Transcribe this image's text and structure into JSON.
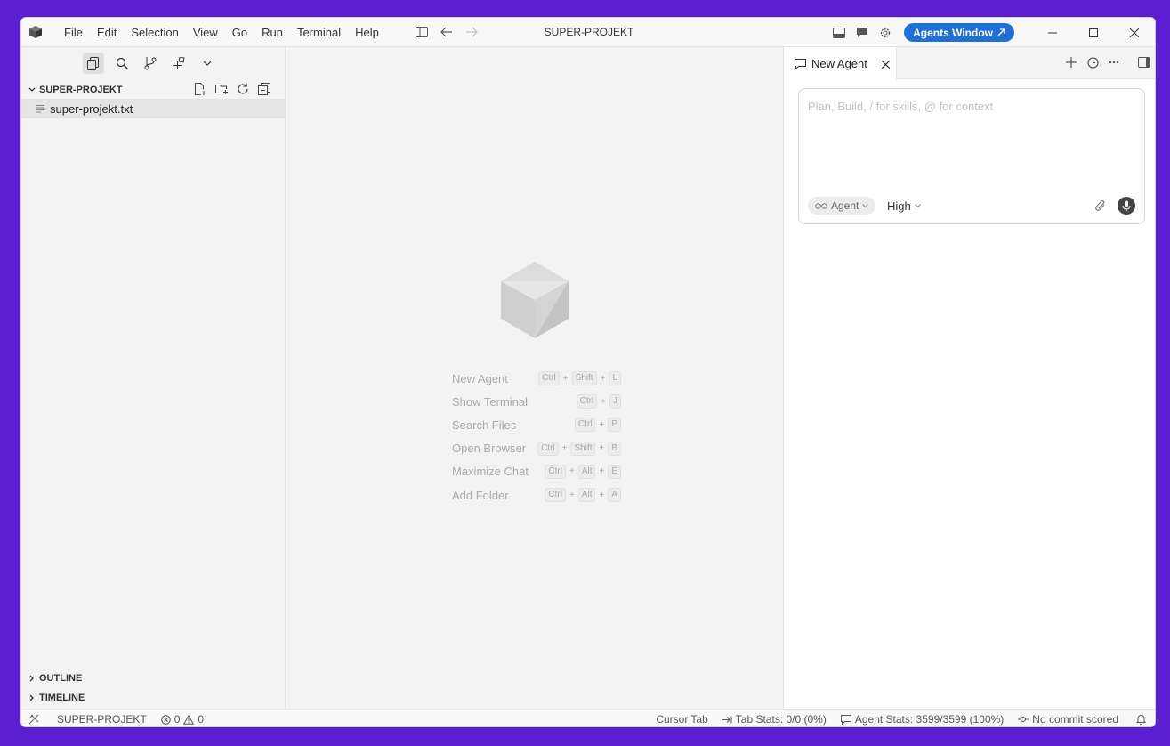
{
  "menu": [
    "File",
    "Edit",
    "Selection",
    "View",
    "Go",
    "Run",
    "Terminal",
    "Help"
  ],
  "window_title": "SUPER-PROJEKT",
  "agents_window_label": "Agents Window",
  "explorer": {
    "section_title": "SUPER-PROJEKT",
    "files": [
      "super-projekt.txt"
    ],
    "outline_label": "OUTLINE",
    "timeline_label": "TIMELINE"
  },
  "shortcuts": [
    {
      "label": "New Agent",
      "keys": [
        "Ctrl",
        "Shift",
        "L"
      ]
    },
    {
      "label": "Show Terminal",
      "keys": [
        "Ctrl",
        "J"
      ]
    },
    {
      "label": "Search Files",
      "keys": [
        "Ctrl",
        "P"
      ]
    },
    {
      "label": "Open Browser",
      "keys": [
        "Ctrl",
        "Shift",
        "B"
      ]
    },
    {
      "label": "Maximize Chat",
      "keys": [
        "Ctrl",
        "Alt",
        "E"
      ]
    },
    {
      "label": "Add Folder",
      "keys": [
        "Ctrl",
        "Alt",
        "A"
      ]
    }
  ],
  "panel": {
    "tab_label": "New Agent",
    "composer_placeholder": "Plan, Build, / for skills, @ for context",
    "mode_label": "Agent",
    "effort_label": "High"
  },
  "statusbar": {
    "project": "SUPER-PROJEKT",
    "errors": "0",
    "warnings": "0",
    "cursor_tab": "Cursor Tab",
    "tab_stats": "Tab Stats: 0/0 (0%)",
    "agent_stats": "Agent Stats: 3599/3599 (100%)",
    "commit_score": "No commit scored"
  },
  "colors": {
    "accent": "#1f6fd6",
    "background": "#5a1fd0"
  }
}
